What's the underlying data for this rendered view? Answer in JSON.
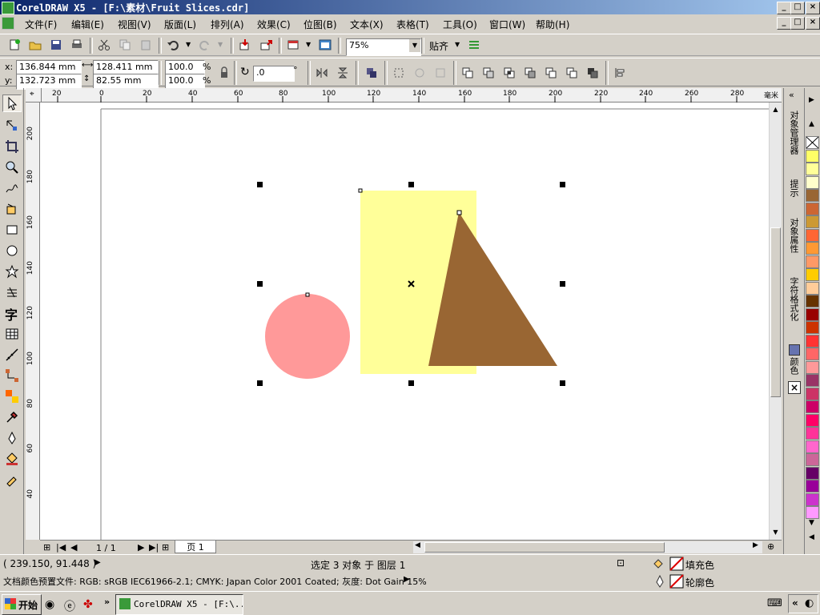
{
  "window": {
    "title": "CorelDRAW X5 - [F:\\素材\\Fruit Slices.cdr]"
  },
  "menu": [
    "文件(F)",
    "编辑(E)",
    "视图(V)",
    "版面(L)",
    "排列(A)",
    "效果(C)",
    "位图(B)",
    "文本(X)",
    "表格(T)",
    "工具(O)",
    "窗口(W)",
    "帮助(H)"
  ],
  "toolbar": {
    "zoom": "75%",
    "snap_label": "贴齐"
  },
  "properties": {
    "x_label": "x:",
    "y_label": "y:",
    "x": "136.844 mm",
    "y": "132.723 mm",
    "width": "128.411 mm",
    "height": "82.55 mm",
    "scale_x": "100.0",
    "scale_y": "100.0",
    "percent": "%",
    "rotation": ".0",
    "degree": "°"
  },
  "ruler": {
    "h_ticks": [
      "20",
      "0",
      "20",
      "40",
      "60",
      "80",
      "100",
      "120",
      "140",
      "160",
      "180",
      "200",
      "220",
      "240",
      "260",
      "280"
    ],
    "v_ticks": [
      "200",
      "180",
      "160",
      "140",
      "120",
      "100",
      "80",
      "60",
      "40"
    ],
    "unit": "毫米"
  },
  "page": {
    "counter": "1 / 1",
    "tab": "页 1"
  },
  "dockers": [
    "对象管理器",
    "提示",
    "对象属性",
    "字符格式化",
    "颜色"
  ],
  "palette": [
    "#ffffff",
    "#ffff66",
    "#ffff99",
    "#ffffcc",
    "#996633",
    "#cc6633",
    "#cc9933",
    "#ff6633",
    "#ff9933",
    "#ff9966",
    "#ffcc00",
    "#ffcc99",
    "#663300",
    "#990000",
    "#cc3300",
    "#ff3333",
    "#ff6666",
    "#ff9999",
    "#993366",
    "#cc3366",
    "#cc0066",
    "#ff0066",
    "#ff3399",
    "#ff66cc",
    "#cc6699",
    "#660066",
    "#990099",
    "#cc33cc",
    "#ff99ff"
  ],
  "shapes": {
    "rect": "#ffff99",
    "circle": "#ff9999",
    "triangle": "#996633"
  },
  "status": {
    "coords": "( 239.150, 91.448 )",
    "selection": "选定 3 对象 于 图层 1",
    "fill_label": "填充色",
    "outline_label": "轮廓色",
    "color_profile": "文档颜色预置文件: RGB: sRGB IEC61966-2.1; CMYK: Japan Color 2001 Coated; 灰度: Dot Gain 15%"
  },
  "taskbar": {
    "start": "开始",
    "app": "CorelDRAW X5 - [F:\\..."
  }
}
